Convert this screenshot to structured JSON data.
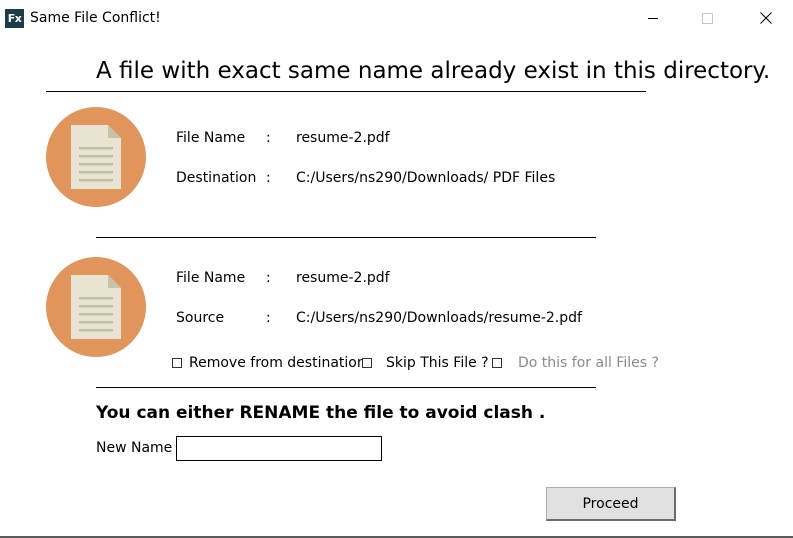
{
  "window": {
    "title": "Same File Conflict!",
    "app_icon_text": "Fx",
    "icon": "fx-app-icon",
    "controls": {
      "minimize_icon": "minimize-icon",
      "maximize_icon": "maximize-icon",
      "close_icon": "close-icon"
    }
  },
  "heading": "A file with exact same name already exist in this directory.",
  "destination_file": {
    "icon": "document-icon",
    "file_name_label": "File Name",
    "file_name_sep": ":",
    "file_name": "resume-2.pdf",
    "path_label": "Destination",
    "path_sep": ":",
    "path": "C:/Users/ns290/Downloads/ PDF Files"
  },
  "source_file": {
    "icon": "document-icon",
    "file_name_label": "File Name",
    "file_name_sep": ":",
    "file_name": "resume-2.pdf",
    "path_label": "Source",
    "path_sep": ":",
    "path": "C:/Users/ns290/Downloads/resume-2.pdf"
  },
  "options": [
    {
      "label": "Remove from destination",
      "checked": false,
      "enabled": true
    },
    {
      "label": "Skip This File ?",
      "checked": false,
      "enabled": true
    },
    {
      "label": "Do this for all Files ?",
      "checked": false,
      "enabled": false
    }
  ],
  "rename": {
    "heading": "You can either RENAME the file to avoid clash .",
    "new_name_label": "New Name :",
    "new_name_value": "",
    "proceed_label": "Proceed"
  },
  "colors": {
    "icon_circle": "#e0955c",
    "document_paper": "#e9e4d1",
    "app_icon_bg": "#1d3c4a",
    "disabled_text": "#8a8a8a"
  }
}
